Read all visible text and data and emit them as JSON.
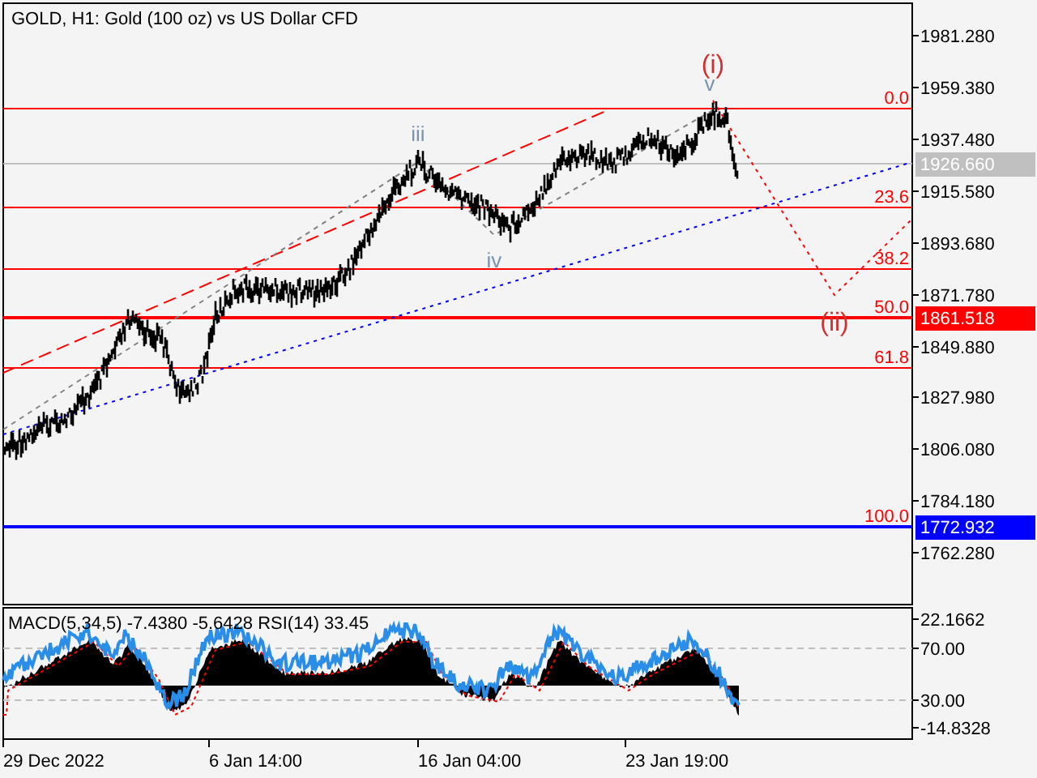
{
  "chart": {
    "title": "GOLD, H1:  Gold (100 oz) vs US Dollar CFD",
    "price_ticks": [
      "1981.280",
      "1959.380",
      "1937.480",
      "1915.580",
      "1893.680",
      "1871.780",
      "1849.880",
      "1827.980",
      "1806.080",
      "1784.180",
      "1762.280"
    ],
    "price_tags": [
      {
        "label": "1926.660",
        "color": "#c0c0c0"
      },
      {
        "label": "1861.518",
        "color": "#ff0000"
      },
      {
        "label": "1772.932",
        "color": "#0000ff"
      }
    ],
    "fib_levels": [
      {
        "label": "0.0"
      },
      {
        "label": "23.6"
      },
      {
        "label": "38.2"
      },
      {
        "label": "50.0"
      },
      {
        "label": "61.8"
      },
      {
        "label": "100.0"
      }
    ],
    "wave_labels": [
      {
        "label": "iii",
        "color": "#7b93ad"
      },
      {
        "label": "iv",
        "color": "#7b93ad"
      },
      {
        "label": "v",
        "color": "#7b93ad"
      },
      {
        "label": "(i)",
        "color": "#d03030"
      },
      {
        "label": "(ii)",
        "color": "#d03030"
      }
    ]
  },
  "indicator": {
    "legend": "MACD(5,34,5) -7.4380 -5.6428 RSI(14) 33.45",
    "ticks": [
      "22.1662",
      "70.00",
      "30.00",
      "-14.8328"
    ]
  },
  "time_axis": [
    "29 Dec 2022",
    "6 Jan 14:00",
    "16 Jan 04:00",
    "23 Jan 19:00"
  ]
}
